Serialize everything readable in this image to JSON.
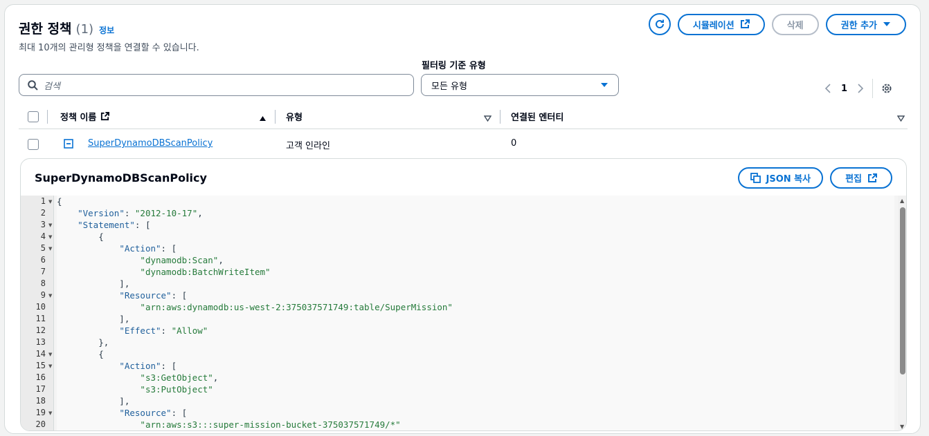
{
  "header": {
    "title": "권한 정책",
    "count": "(1)",
    "info": "정보",
    "subtitle": "최대 10개의 관리형 정책을 연결할 수 있습니다."
  },
  "actions": {
    "simulate": "시뮬레이션",
    "delete": "삭제",
    "add": "권한 추가"
  },
  "filter": {
    "search_placeholder": "검색",
    "type_label": "필터링 기준 유형",
    "type_value": "모든 유형"
  },
  "pagination": {
    "page": "1"
  },
  "table": {
    "columns": [
      "정책 이름",
      "유형",
      "연결된 엔터티"
    ],
    "rows": [
      {
        "name": "SuperDynamoDBScanPolicy",
        "type": "고객 인라인",
        "entities": "0"
      }
    ]
  },
  "detail": {
    "title": "SuperDynamoDBScanPolicy",
    "copy_json": "JSON 복사",
    "edit": "편집"
  },
  "code": {
    "line_numbers": [
      "1",
      "2",
      "3",
      "4",
      "5",
      "6",
      "7",
      "8",
      "9",
      "10",
      "11",
      "12",
      "13",
      "14",
      "15",
      "16",
      "17",
      "18",
      "19",
      "20"
    ],
    "folded_lines": [
      1,
      3,
      4,
      5,
      9,
      14,
      15,
      19
    ],
    "lines": [
      "{",
      "    \"Version\": \"2012-10-17\",",
      "    \"Statement\": [",
      "        {",
      "            \"Action\": [",
      "                \"dynamodb:Scan\",",
      "                \"dynamodb:BatchWriteItem\"",
      "            ],",
      "            \"Resource\": [",
      "                \"arn:aws:dynamodb:us-west-2:375037571749:table/SuperMission\"",
      "            ],",
      "            \"Effect\": \"Allow\"",
      "        },",
      "        {",
      "            \"Action\": [",
      "                \"s3:GetObject\",",
      "                \"s3:PutObject\"",
      "            ],",
      "            \"Resource\": [",
      "                \"arn:aws:s3:::super-mission-bucket-375037571749/*\""
    ]
  },
  "colors": {
    "accent": "#0972d3",
    "text": "#000716",
    "border": "#d5dbdb"
  }
}
